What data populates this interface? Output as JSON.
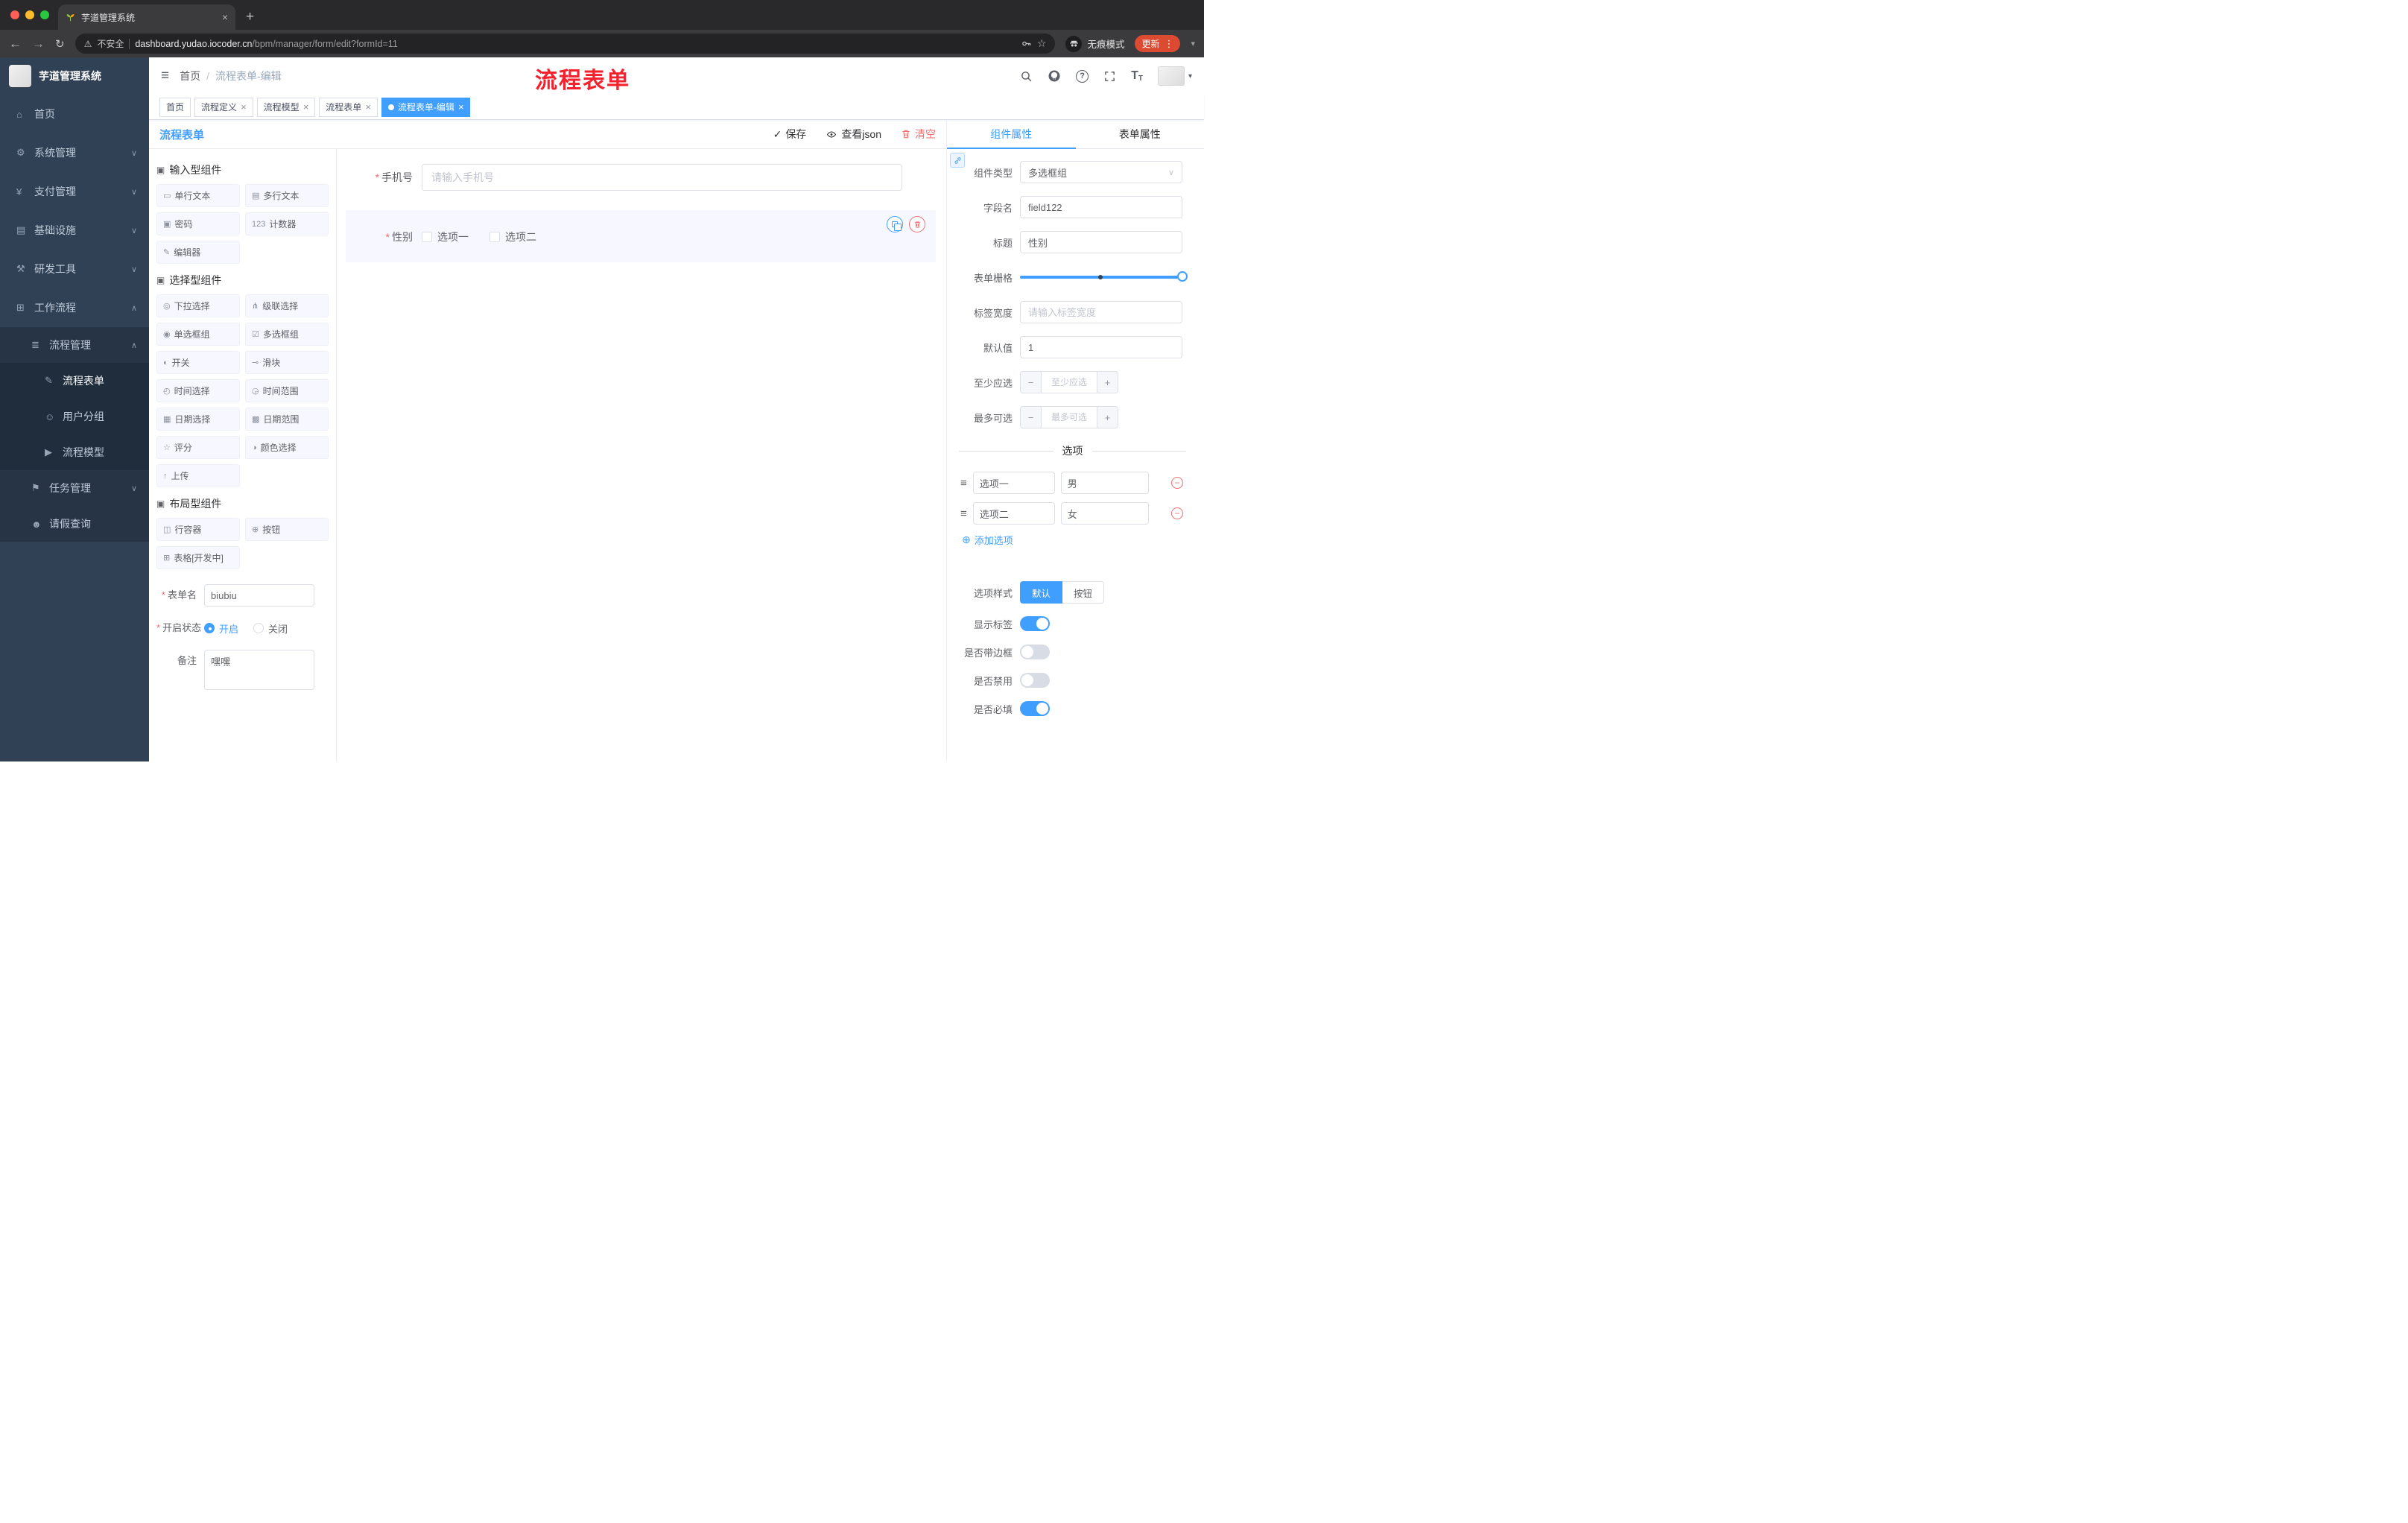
{
  "colors": {
    "accent": "#409eff",
    "danger": "#f56c6c",
    "annotation_red": "#f5222d",
    "sidebar_bg": "#304156",
    "update_badge": "#dd4a32"
  },
  "icons": {
    "hamburger": "≡",
    "back": "←",
    "forward": "→",
    "reload": "↻",
    "warning": "⚠",
    "close": "×",
    "new_tab": "+",
    "star": "☆",
    "dots": "⋮",
    "caret_down": "▾",
    "chevron_down": "∨",
    "breadcrumb_sep": "/",
    "check": "✓",
    "cube": "▣",
    "circle_plus": "⊕",
    "minus": "−",
    "plus": "+",
    "question": "?",
    "font_size": "T",
    "drag": "≡"
  },
  "browser": {
    "tab_title": "芋道管理系统",
    "security_label": "不安全",
    "url_host": "dashboard.yudao.iocoder.cn",
    "url_path": "/bpm/manager/form/edit?formId=11",
    "incognito_label": "无痕模式",
    "update_label": "更新"
  },
  "sidebar": {
    "logo_title": "芋道管理系统",
    "menu": [
      {
        "icon": "⌂",
        "label": "首页",
        "arrow": "",
        "cls": "lvl1"
      },
      {
        "icon": "⚙",
        "label": "系统管理",
        "arrow": "∨",
        "cls": "lvl1"
      },
      {
        "icon": "¥",
        "label": "支付管理",
        "arrow": "∨",
        "cls": "lvl1"
      },
      {
        "icon": "▤",
        "label": "基础设施",
        "arrow": "∨",
        "cls": "lvl1"
      },
      {
        "icon": "⚒",
        "label": "研发工具",
        "arrow": "∨",
        "cls": "lvl1"
      },
      {
        "icon": "⊞",
        "label": "工作流程",
        "arrow": "∧",
        "cls": "lvl1 open"
      },
      {
        "icon": "≣",
        "label": "流程管理",
        "arrow": "∧",
        "cls": "lvl2"
      },
      {
        "icon": "✎",
        "label": "流程表单",
        "arrow": "",
        "cls": "lvl3 active"
      },
      {
        "icon": "☺",
        "label": "用户分组",
        "arrow": "",
        "cls": "lvl3"
      },
      {
        "icon": "▶",
        "label": "流程模型",
        "arrow": "",
        "cls": "lvl3"
      },
      {
        "icon": "⚑",
        "label": "任务管理",
        "arrow": "∨",
        "cls": "lvl2"
      },
      {
        "icon": "☻",
        "label": "请假查询",
        "arrow": "",
        "cls": "lvl2"
      }
    ]
  },
  "header": {
    "breadcrumb_root": "首页",
    "breadcrumb_current": "流程表单-编辑",
    "annotation": "流程表单"
  },
  "tags": [
    {
      "label": "首页",
      "cls": "affix"
    },
    {
      "label": "流程定义",
      "cls": ""
    },
    {
      "label": "流程模型",
      "cls": ""
    },
    {
      "label": "流程表单",
      "cls": ""
    },
    {
      "label": "流程表单-编辑",
      "cls": "active"
    }
  ],
  "designer": {
    "title": "流程表单",
    "save_label": "保存",
    "view_json_label": "查看json",
    "clear_label": "清空",
    "palette": {
      "input_title": "输入型组件",
      "input_items": [
        {
          "icon": "▭",
          "label": "单行文本"
        },
        {
          "icon": "▤",
          "label": "多行文本"
        },
        {
          "icon": "▣",
          "label": "密码"
        },
        {
          "icon": "123",
          "label": "计数器"
        },
        {
          "icon": "✎",
          "label": "编辑器"
        }
      ],
      "select_title": "选择型组件",
      "select_items": [
        {
          "icon": "◎",
          "label": "下拉选择"
        },
        {
          "icon": "⋔",
          "label": "级联选择"
        },
        {
          "icon": "◉",
          "label": "单选框组"
        },
        {
          "icon": "☑",
          "label": "多选框组"
        },
        {
          "icon": "◐",
          "label": "开关"
        },
        {
          "icon": "⊸",
          "label": "滑块"
        },
        {
          "icon": "◴",
          "label": "时间选择"
        },
        {
          "icon": "◶",
          "label": "时间范围"
        },
        {
          "icon": "▦",
          "label": "日期选择"
        },
        {
          "icon": "▩",
          "label": "日期范围"
        },
        {
          "icon": "☆",
          "label": "评分"
        },
        {
          "icon": "◑",
          "label": "颜色选择"
        },
        {
          "icon": "↑",
          "label": "上传"
        }
      ],
      "layout_title": "布局型组件",
      "layout_items": [
        {
          "icon": "◫",
          "label": "行容器"
        },
        {
          "icon": "⊕",
          "label": "按钮"
        },
        {
          "icon": "⊞",
          "label": "表格[开发中]"
        }
      ]
    },
    "meta": {
      "form_name_label": "表单名",
      "form_name_value": "biubiu",
      "status_label": "开启状态",
      "status_on": "开启",
      "status_off": "关闭",
      "remark_label": "备注",
      "remark_value": "嘿嘿"
    },
    "canvas": {
      "phone_label": "手机号",
      "phone_placeholder": "请输入手机号",
      "gender_label": "性别",
      "gender_options": [
        {
          "label": "选项一"
        },
        {
          "label": "选项二"
        }
      ]
    }
  },
  "props": {
    "tab_component": "组件属性",
    "tab_form": "表单属性",
    "type_label": "组件类型",
    "type_value": "多选框组",
    "field_label": "字段名",
    "field_value": "field122",
    "title_label": "标题",
    "title_value": "性别",
    "grid_label": "表单栅格",
    "tag_width_label": "标签宽度",
    "tag_width_placeholder": "请输入标签宽度",
    "default_label": "默认值",
    "default_value": "1",
    "min_label": "至少应选",
    "min_placeholder": "至少应选",
    "max_label": "最多可选",
    "max_placeholder": "最多可选",
    "options_title": "选项",
    "options": [
      {
        "label": "选项一",
        "value": "男"
      },
      {
        "label": "选项二",
        "value": "女"
      }
    ],
    "add_option_label": "添加选项",
    "style_label": "选项样式",
    "style_default": "默认",
    "style_button": "按钮",
    "toggles": [
      {
        "label": "显示标签",
        "state": "on"
      },
      {
        "label": "是否带边框",
        "state": "off"
      },
      {
        "label": "是否禁用",
        "state": "off"
      },
      {
        "label": "是否必填",
        "state": "on"
      }
    ]
  }
}
